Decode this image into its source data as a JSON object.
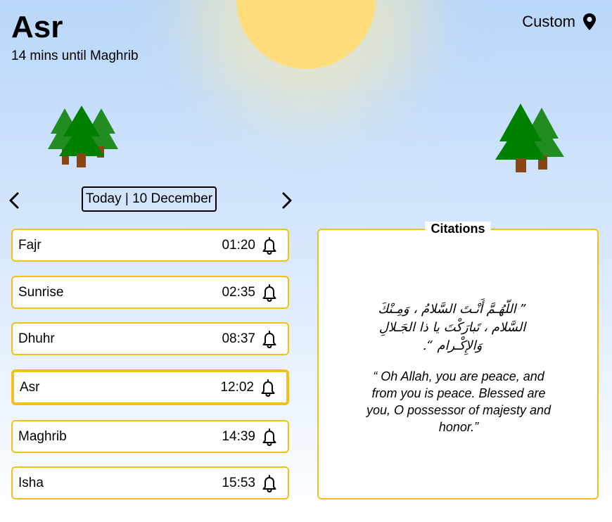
{
  "header": {
    "current_prayer": "Asr",
    "countdown": "14 mins until Maghrib",
    "location_label": "Custom"
  },
  "date_nav": {
    "label": "Today | 10 December"
  },
  "prayers": [
    {
      "name": "Fajr",
      "time": "01:20",
      "active": false
    },
    {
      "name": "Sunrise",
      "time": "02:35",
      "active": false
    },
    {
      "name": "Dhuhr",
      "time": "08:37",
      "active": false
    },
    {
      "name": "Asr",
      "time": "12:02",
      "active": true
    },
    {
      "name": "Maghrib",
      "time": "14:39",
      "active": false
    },
    {
      "name": "Isha",
      "time": "15:53",
      "active": false
    }
  ],
  "citations": {
    "heading": "Citations",
    "arabic": "” اللّهُـمَّ أَنْـتَ السَّلامُ ، وَمِـنْكَ السَّلام ، تَبارَكْتَ يا ذا الجَـلالِ وَالإِكْـرام “.",
    "english": "“ Oh Allah, you are peace, and from you is peace. Blessed are you, O possessor of majesty and honor.”"
  },
  "colors": {
    "accent_border": "#f2c01a",
    "sun": "#ffdd7a",
    "tree_dark": "#008000",
    "tree_light": "#228b22",
    "trunk": "#8b4513"
  },
  "icons": [
    "location-pin-icon",
    "chevron-left-icon",
    "chevron-right-icon",
    "bell-icon"
  ]
}
